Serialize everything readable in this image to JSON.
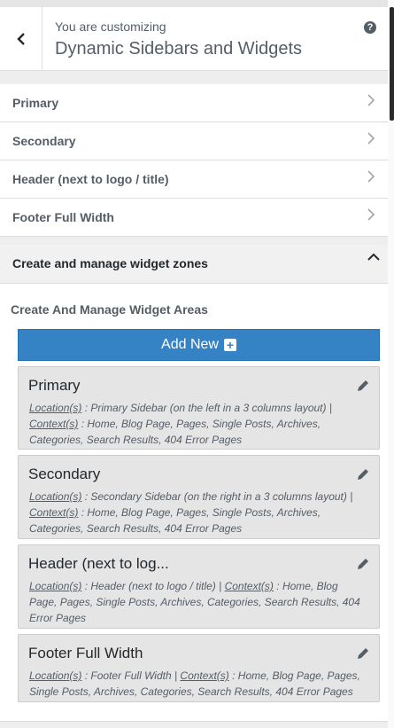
{
  "header": {
    "subtitle": "You are customizing",
    "title": "Dynamic Sidebars and Widgets"
  },
  "sections": [
    {
      "label": "Primary"
    },
    {
      "label": "Secondary"
    },
    {
      "label": "Header (next to logo / title)"
    },
    {
      "label": "Footer Full Width"
    }
  ],
  "zone": {
    "label": "Create and manage widget zones",
    "heading": "Create And Manage Widget Areas",
    "add_new_label": "Add New"
  },
  "cards": [
    {
      "title": "Primary",
      "location_label": "Location(s)",
      "location_value": " : Primary Sidebar (on the left in a 3 columns layout) | ",
      "context_label": "Context(s)",
      "context_value": " : Home, Blog Page, Pages, Single Posts, Archives, Categories, Search Results, 404 Error Pages"
    },
    {
      "title": "Secondary",
      "location_label": "Location(s)",
      "location_value": " : Secondary Sidebar (on the right in a 3 columns layout) | ",
      "context_label": "Context(s)",
      "context_value": " : Home, Blog Page, Pages, Single Posts, Archives, Categories, Search Results, 404 Error Pages"
    },
    {
      "title": "Header (next to log...",
      "location_label": "Location(s)",
      "location_value": " : Header (next to logo / title) | ",
      "context_label": "Context(s)",
      "context_value": " : Home, Blog Page, Pages, Single Posts, Archives, Categories, Search Results, 404 Error Pages"
    },
    {
      "title": "Footer Full Width",
      "location_label": "Location(s)",
      "location_value": " : Footer Full Width | ",
      "context_label": "Context(s)",
      "context_value": " : Home, Blog Page, Pages, Single Posts, Archives, Categories, Search Results, 404 Error Pages"
    }
  ],
  "colors": {
    "accent": "#3582c4",
    "card_bg": "#e5e5e5"
  }
}
